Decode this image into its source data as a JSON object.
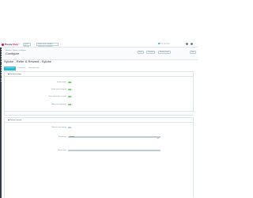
{
  "topbar": {
    "brand_prefix": "Presta",
    "brand_accent": "Shop",
    "version": "1.7.x",
    "quick_access": "Quick Access",
    "search_placeholder": "Search (e.g.: product reference, customer)",
    "view_shop": "View my shop"
  },
  "header": {
    "breadcrumb": "Modules / Sylobe / Configure",
    "title": "Configure",
    "buttons": [
      "Back",
      "Translate",
      "Manage hooks",
      "Help"
    ]
  },
  "module": {
    "title": "Sylobe - Refer & Reward - Sylobe",
    "tabs": [
      "Configuration",
      "Customers",
      "Documentation"
    ]
  },
  "general": {
    "heading": "General settings",
    "rows": [
      {
        "label": "Enable module",
        "value": "YES"
      },
      {
        "label": "Enable referral program",
        "value": "YES"
      },
      {
        "label": "Show referral link in account",
        "value": "YES"
      },
      {
        "label": "Allow guest registration",
        "value": "YES"
      }
    ]
  },
  "rewards": {
    "heading": "Referral rewards",
    "amount_label": "Minimum order amount",
    "amount_value": "0",
    "type_label": "Reward type",
    "type_value": "Voucher",
    "value_label": "Reward value"
  },
  "colors": {
    "accent": "#25b9d7",
    "brand": "#df0067",
    "switch_on": "#78d07d",
    "sidebar": "#363a41"
  }
}
